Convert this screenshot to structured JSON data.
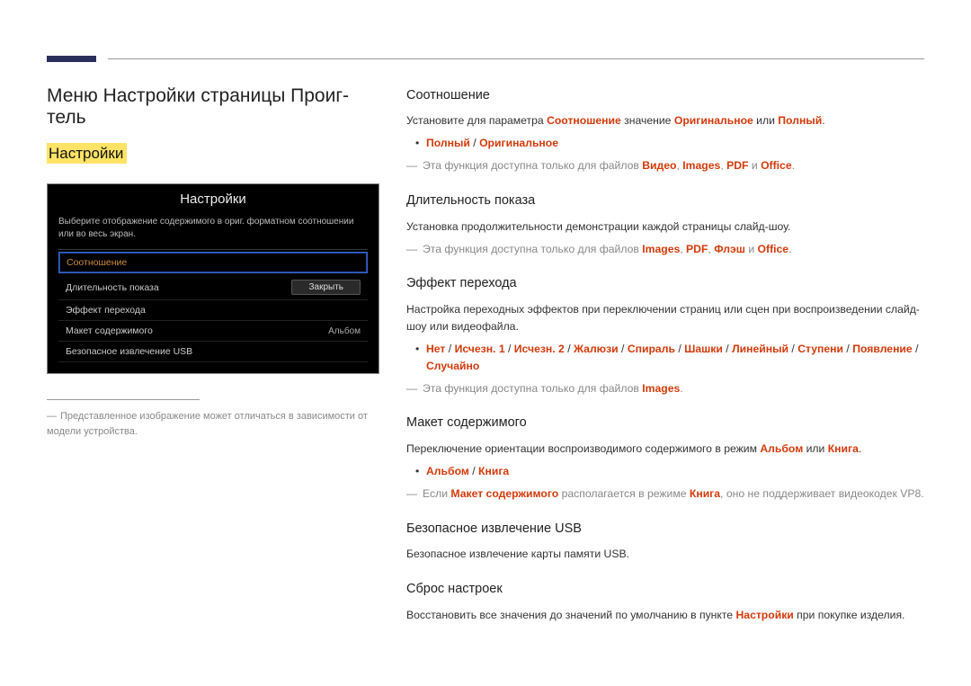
{
  "left": {
    "h1": "Меню Настройки страницы Проиг-тель",
    "h2": "Настройки",
    "osd": {
      "title": "Настройки",
      "desc": "Выберите отображение содержимого в ориг. форматном соотношении или во весь экран.",
      "items": [
        {
          "label": "Соотношение",
          "right": "",
          "active": true
        },
        {
          "label": "Длительность показа",
          "right": ""
        },
        {
          "label": "Эффект перехода",
          "right": ""
        },
        {
          "label": "Макет содержимого",
          "right": "Альбом"
        },
        {
          "label": "Безопасное извлечение USB",
          "right": ""
        }
      ],
      "close": "Закрыть"
    },
    "footnote": "Представленное изображение может отличаться в зависимости от модели устройства."
  },
  "right": {
    "ratio": {
      "h": "Соотношение",
      "p_a": "Установите для параметра ",
      "p_k1": "Соотношение",
      "p_b": " значение ",
      "p_k2": "Оригинальное",
      "p_c": " или ",
      "p_k3": "Полный",
      "p_d": ".",
      "opt1": "Полный",
      "opt2": "Оригинальное",
      "note_a": "Эта функция доступна только для файлов ",
      "note_k1": "Видео",
      "note_s": ", ",
      "note_k2": "Images",
      "note_k3": "PDF",
      "note_and": " и ",
      "note_k4": "Office",
      "note_end": "."
    },
    "duration": {
      "h": "Длительность показа",
      "p": "Установка продолжительности демонстрации каждой страницы слайд-шоу.",
      "note_a": "Эта функция доступна только для файлов ",
      "note_k1": "Images",
      "note_s": ", ",
      "note_k2": "PDF",
      "note_k3": "Флэш",
      "note_and": " и ",
      "note_k4": "Office",
      "note_end": "."
    },
    "effect": {
      "h": "Эффект перехода",
      "p": "Настройка переходных эффектов при переключении страниц или сцен при воспроизведении слайд-шоу или видеофайла.",
      "opts": [
        "Нет",
        "Исчезн. 1",
        "Исчезн. 2",
        "Жалюзи",
        "Спираль",
        "Шашки",
        "Линейный",
        "Ступени",
        "Появление",
        "Случайно"
      ],
      "note_a": "Эта функция доступна только для файлов ",
      "note_k1": "Images",
      "note_end": "."
    },
    "layout": {
      "h": "Макет содержимого",
      "p_a": "Переключение ориентации воспроизводимого содержимого в режим ",
      "p_k1": "Альбом",
      "p_b": " или ",
      "p_k2": "Книга",
      "p_c": ".",
      "opt1": "Альбом",
      "opt2": "Книга",
      "note_a": "Если ",
      "note_k1": "Макет содержимого",
      "note_b": " располагается в режиме ",
      "note_k2": "Книга",
      "note_c": ", оно не поддерживает видеокодек VP8."
    },
    "usb": {
      "h": "Безопасное извлечение USB",
      "p": "Безопасное извлечение карты памяти USB."
    },
    "reset": {
      "h": "Сброс настроек",
      "p_a": "Восстановить все значения до значений по умолчанию в пункте ",
      "p_k1": "Настройки",
      "p_b": " при покупке изделия."
    }
  }
}
